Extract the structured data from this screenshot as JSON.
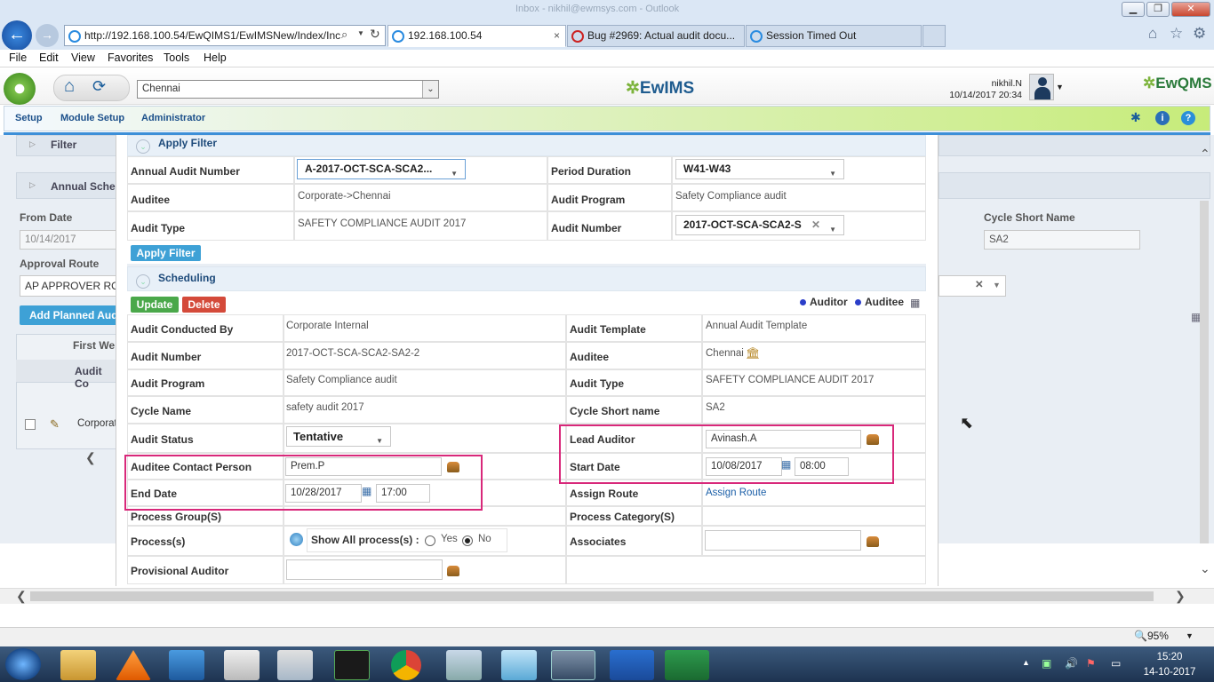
{
  "browser": {
    "title_bar_text": "Inbox - nikhil@ewmsys.com - Outlook",
    "window_controls": [
      "minimize",
      "restore",
      "close"
    ],
    "address": "http://192.168.100.54/EwQIMS1/EwIMSNew/Index/Inc",
    "tabs": [
      {
        "label": "192.168.100.54",
        "active": true
      },
      {
        "label": "Bug #2969: Actual audit docu...",
        "active": false
      },
      {
        "label": "Session Timed Out",
        "active": false
      }
    ],
    "menu": [
      "File",
      "Edit",
      "View",
      "Favorites",
      "Tools",
      "Help"
    ]
  },
  "app": {
    "location_select": "Chennai",
    "logo_center": "EwIMS",
    "logo_right": "EwQMS",
    "user_name": "nikhil.N",
    "user_datetime": "10/14/2017 20:34",
    "module_nav": [
      "Setup",
      "Module Setup",
      "Administrator"
    ]
  },
  "background": {
    "filter_label": "Filter",
    "annual_sched_label": "Annual Sche",
    "from_date_label": "From Date",
    "from_date_value": "10/14/2017",
    "approval_route_label": "Approval Route",
    "approval_route_value": "AP APPROVER RO",
    "add_planned_label": "Add Planned Aud",
    "first_week_label": "First We",
    "audit_col_label": "Audit Co",
    "row_text": "Corporat",
    "cycle_short_label": "Cycle Short Name",
    "cycle_short_value": "SA2"
  },
  "apply_filter": {
    "section_title": "Apply Filter",
    "annual_audit_number_label": "Annual Audit Number",
    "annual_audit_number_value": "A-2017-OCT-SCA-SCA2...",
    "period_duration_label": "Period Duration",
    "period_duration_value": "W41-W43",
    "auditee_label": "Auditee",
    "auditee_value": "Corporate->Chennai",
    "audit_program_label": "Audit Program",
    "audit_program_value": "Safety Compliance audit",
    "audit_type_label": "Audit Type",
    "audit_type_value": "SAFETY COMPLIANCE AUDIT 2017",
    "audit_number_label": "Audit Number",
    "audit_number_value": "2017-OCT-SCA-SCA2-S",
    "button_label": "Apply Filter"
  },
  "scheduling": {
    "section_title": "Scheduling",
    "update_label": "Update",
    "delete_label": "Delete",
    "legend_auditor": "Auditor",
    "legend_auditee": "Auditee",
    "fields": {
      "audit_conducted_by_label": "Audit Conducted By",
      "audit_conducted_by_value": "Corporate Internal",
      "audit_template_label": "Audit Template",
      "audit_template_value": "Annual Audit Template",
      "audit_number_label": "Audit Number",
      "audit_number_value": "2017-OCT-SCA-SCA2-SA2-2",
      "auditee_label": "Auditee",
      "auditee_value": "Chennai",
      "audit_program_label": "Audit Program",
      "audit_program_value": "Safety Compliance audit",
      "audit_type_label": "Audit Type",
      "audit_type_value": "SAFETY COMPLIANCE AUDIT 2017",
      "cycle_name_label": "Cycle Name",
      "cycle_name_value": "safety audit 2017",
      "cycle_short_name_label": "Cycle Short name",
      "cycle_short_name_value": "SA2",
      "audit_status_label": "Audit Status",
      "audit_status_value": "Tentative",
      "lead_auditor_label": "Lead Auditor",
      "lead_auditor_value": "Avinash.A",
      "auditee_contact_label": "Auditee Contact Person",
      "auditee_contact_value": "Prem.P",
      "start_date_label": "Start Date",
      "start_date_value": "10/08/2017",
      "start_time_value": "08:00",
      "end_date_label": "End Date",
      "end_date_value": "10/28/2017",
      "end_time_value": "17:00",
      "assign_route_label": "Assign Route",
      "assign_route_link": "Assign Route",
      "process_group_label": "Process Group(S)",
      "process_category_label": "Process Category(S)",
      "processes_label": "Process(s)",
      "show_all_label": "Show All process(s) :",
      "yes_label": "Yes",
      "no_label": "No",
      "show_all_selected": "No",
      "associates_label": "Associates",
      "associates_value": "",
      "provisional_auditor_label": "Provisional Auditor",
      "provisional_auditor_value": ""
    }
  },
  "status_bar": {
    "zoom": "95%"
  },
  "taskbar": {
    "time": "15:20",
    "date": "14-10-2017"
  }
}
